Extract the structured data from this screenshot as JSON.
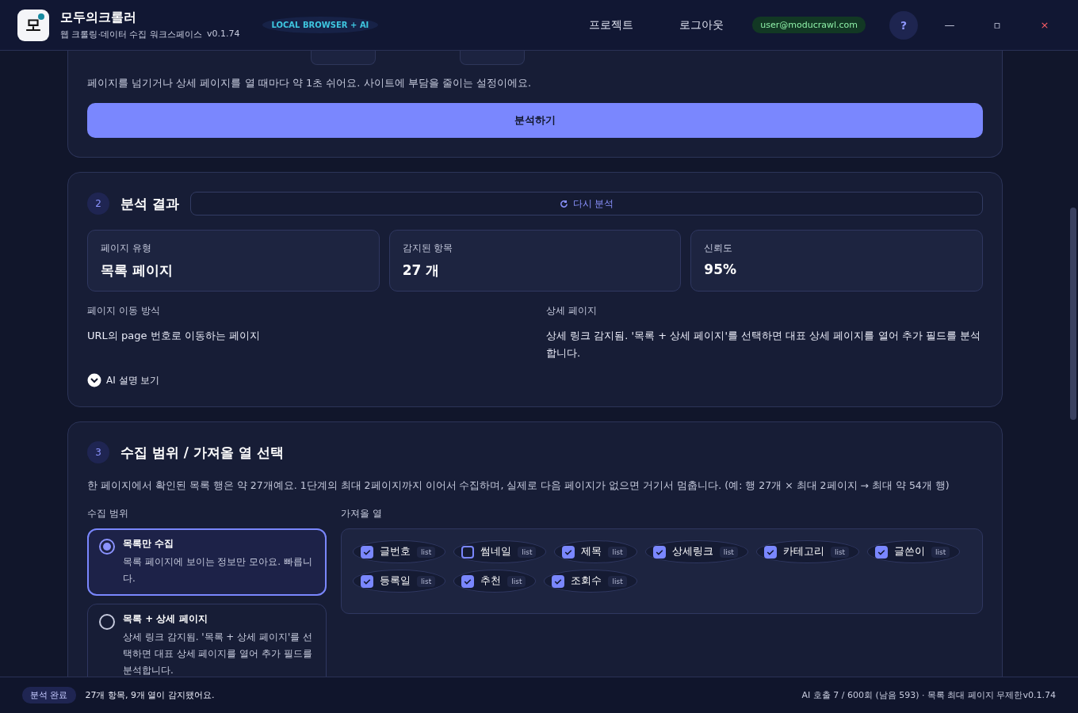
{
  "header": {
    "app_name": "모두의크롤러",
    "logo_letter": "모",
    "subtitle": "웹 크롤링·데이터 수집 워크스페이스",
    "version": "v0.1.74",
    "mode_badge": "LOCAL BROWSER + AI",
    "nav": [
      "프로젝트",
      "로그아웃"
    ],
    "user_email": "user@moducrawl.com",
    "help": "?",
    "window_controls": [
      {
        "kind": "minimize",
        "label": "—"
      },
      {
        "kind": "maximize",
        "label": "▫"
      },
      {
        "kind": "close",
        "label": "×"
      }
    ]
  },
  "step1": {
    "note": "페이지를 넘기거나 상세 페이지를 열 때마다 약 1초 쉬어요. 사이트에 부담을 줄이는 설정이에요.",
    "button": "분석하기"
  },
  "step2": {
    "number": "2",
    "title": "분석 결과",
    "reanalyze": "다시 분석",
    "metrics": [
      {
        "label": "페이지 유형",
        "value": "목록 페이지"
      },
      {
        "label": "감지된 항목",
        "value": "27 개"
      },
      {
        "label": "신뢰도",
        "value": "95%"
      }
    ],
    "details": [
      {
        "label": "페이지 이동 방식",
        "text": "URL의 page 번호로 이동하는 페이지"
      },
      {
        "label": "상세 페이지",
        "text": "상세 링크 감지됨. '목록 + 상세 페이지'를 선택하면 대표 상세 페이지를 열어 추가 필드를 분석합니다."
      }
    ],
    "ai_toggle": {
      "label": "AI 설명 보기",
      "expanded": false
    }
  },
  "step3": {
    "number": "3",
    "title": "수집 범위 / 가져올 열 선택",
    "description": "한 페이지에서 확인된 목록 행은 약 27개예요. 1단계의 최대 2페이지까지 이어서 수집하며, 실제로 다음 페이지가 없으면 거기서 멈춥니다. (예: 행 27개 × 최대 2페이지 → 최대 약 54개 행)",
    "scope_label": "수집 범위",
    "scopes": [
      {
        "title": "목록만 수집",
        "description": "목록 페이지에 보이는 정보만 모아요. 빠릅니다.",
        "selected": true
      },
      {
        "title": "목록 + 상세 페이지",
        "description": "상세 링크 감지됨. '목록 + 상세 페이지'를 선택하면 대표 상세 페이지를 열어 추가 필드를 분석합니다.",
        "selected": false
      }
    ],
    "columns_label": "가져올 열",
    "columns": [
      {
        "label": "글번호",
        "tag": "list",
        "checked": true
      },
      {
        "label": "썸네일",
        "tag": "list",
        "checked": false
      },
      {
        "label": "제목",
        "tag": "list",
        "checked": true
      },
      {
        "label": "상세링크",
        "tag": "list",
        "checked": true
      },
      {
        "label": "카테고리",
        "tag": "list",
        "checked": true
      },
      {
        "label": "글쓴이",
        "tag": "list",
        "checked": true
      },
      {
        "label": "등록일",
        "tag": "list",
        "checked": true
      },
      {
        "label": "추천",
        "tag": "list",
        "checked": true
      },
      {
        "label": "조회수",
        "tag": "list",
        "checked": true
      }
    ]
  },
  "status_bar": {
    "badge": "분석 완료",
    "message": "27개 항목, 9개 열이 감지됐어요.",
    "usage": "AI 호출 7 / 600회 (남음 593) · 목록 최대 페이지 무제한v0.1.74"
  }
}
